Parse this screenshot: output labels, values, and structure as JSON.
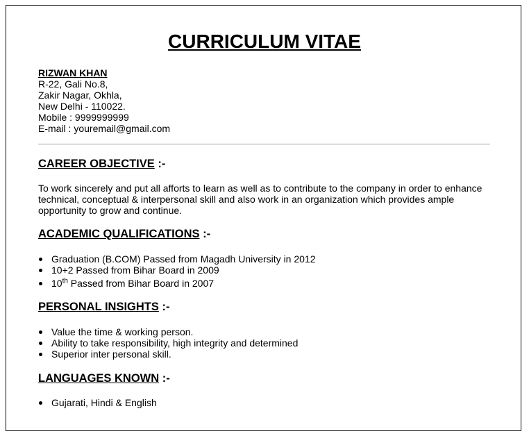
{
  "title": "CURRICULUM VITAE",
  "contact": {
    "name": "RIZWAN KHAN",
    "address_line1": "R-22, Gali No.8,",
    "address_line2": "Zakir Nagar, Okhla,",
    "address_line3": "New Delhi - 110022.",
    "mobile": "Mobile : 9999999999",
    "email": "E-mail : youremail@gmail.com"
  },
  "career_objective": {
    "heading": "CAREER OBJECTIVE",
    "suffix": " :-",
    "text": "To work sincerely and put all afforts to learn as well as to contribute to the company in order to enhance technical, conceptual & interpersonal skill and also work in an organization which provides ample opportunity to grow and continue."
  },
  "academic": {
    "heading": "ACADEMIC QUALIFICATIONS",
    "suffix": " :-",
    "items": [
      "Graduation (B.COM) Passed from Magadh University in 2012",
      "10+2 Passed from Bihar Board in 2009"
    ],
    "item3_prefix": "10",
    "item3_sup": "th",
    "item3_rest": " Passed from Bihar Board in 2007"
  },
  "personal": {
    "heading": "PERSONAL INSIGHTS",
    "suffix": " :-",
    "items": [
      "Value the time & working person.",
      "Ability to take responsibility, high integrity and determined",
      "Superior inter personal skill."
    ]
  },
  "languages": {
    "heading": "LANGUAGES KNOWN",
    "suffix": " :-",
    "items": [
      "Gujarati, Hindi & English"
    ]
  }
}
